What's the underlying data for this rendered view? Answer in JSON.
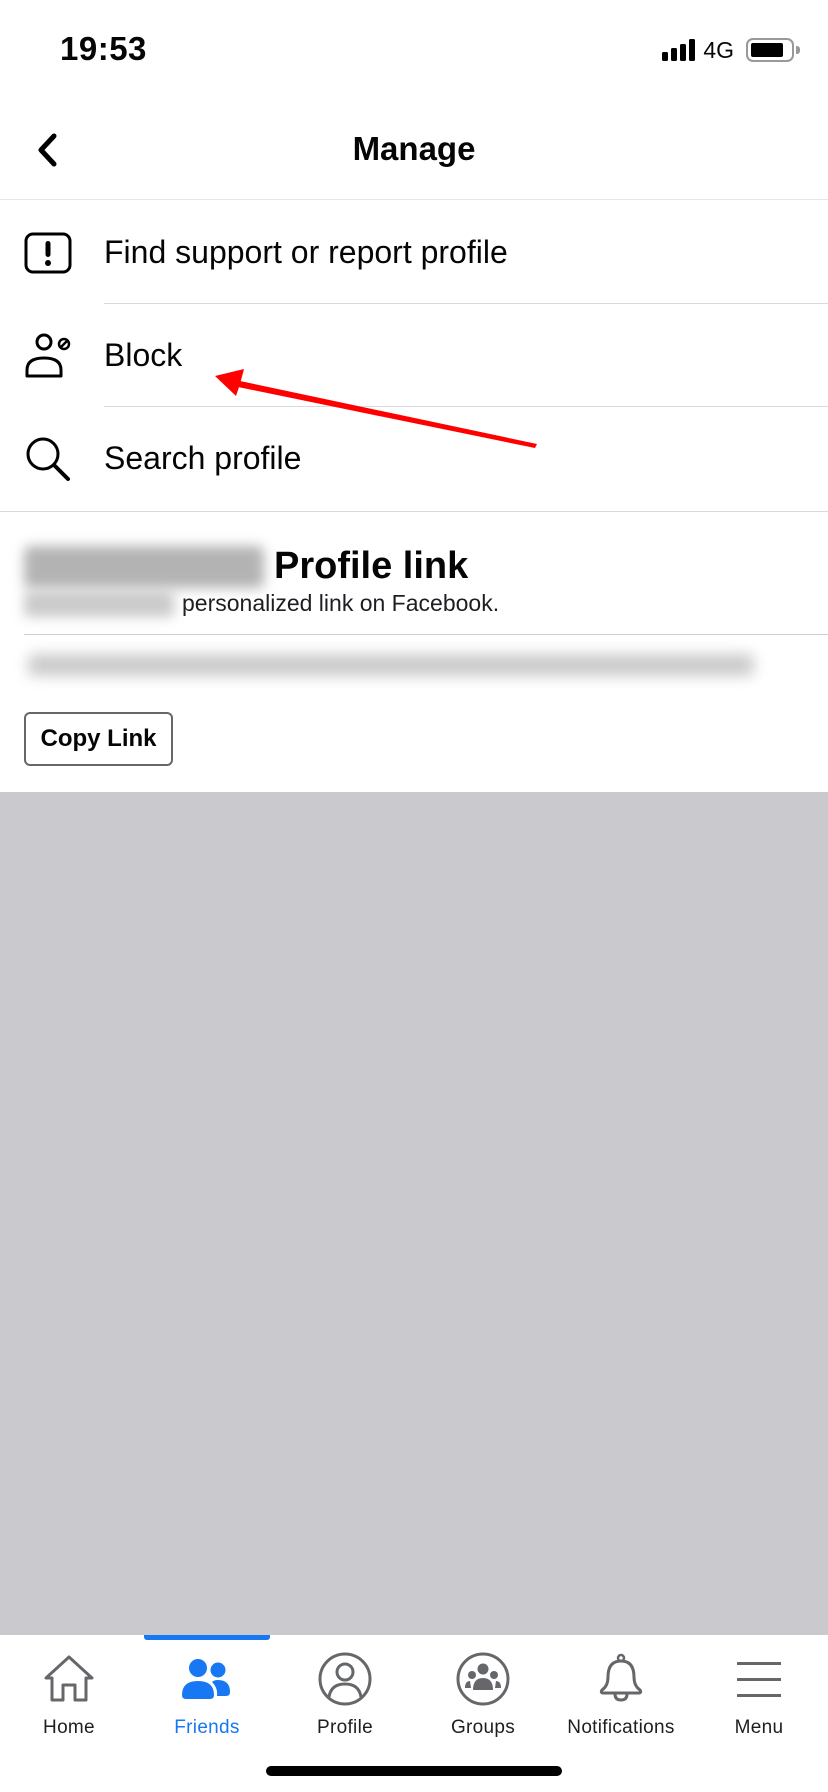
{
  "status_bar": {
    "time": "19:53",
    "network": "4G",
    "icons": [
      "signal-icon",
      "battery-icon"
    ]
  },
  "header": {
    "title": "Manage",
    "back_icon": "chevron-left-icon"
  },
  "menu": {
    "items": [
      {
        "label": "Find support or report profile",
        "icon": "report-exclamation-icon"
      },
      {
        "label": "Block",
        "icon": "block-user-icon"
      },
      {
        "label": "Search profile",
        "icon": "search-icon"
      }
    ]
  },
  "annotation": {
    "type": "red-arrow",
    "points_to": "Block",
    "color": "#ff0000"
  },
  "profile_link": {
    "title_suffix": "Profile link",
    "subtitle_suffix": "personalized link on Facebook.",
    "name_redacted": true,
    "url_redacted": true,
    "copy_button_label": "Copy Link"
  },
  "tab_bar": {
    "active_color": "#1877f2",
    "tabs": [
      {
        "label": "Home",
        "icon": "home-icon",
        "active": false
      },
      {
        "label": "Friends",
        "icon": "friends-icon",
        "active": true
      },
      {
        "label": "Profile",
        "icon": "profile-icon",
        "active": false
      },
      {
        "label": "Groups",
        "icon": "groups-icon",
        "active": false
      },
      {
        "label": "Notifications",
        "icon": "bell-icon",
        "active": false
      },
      {
        "label": "Menu",
        "icon": "hamburger-menu-icon",
        "active": false
      }
    ]
  }
}
